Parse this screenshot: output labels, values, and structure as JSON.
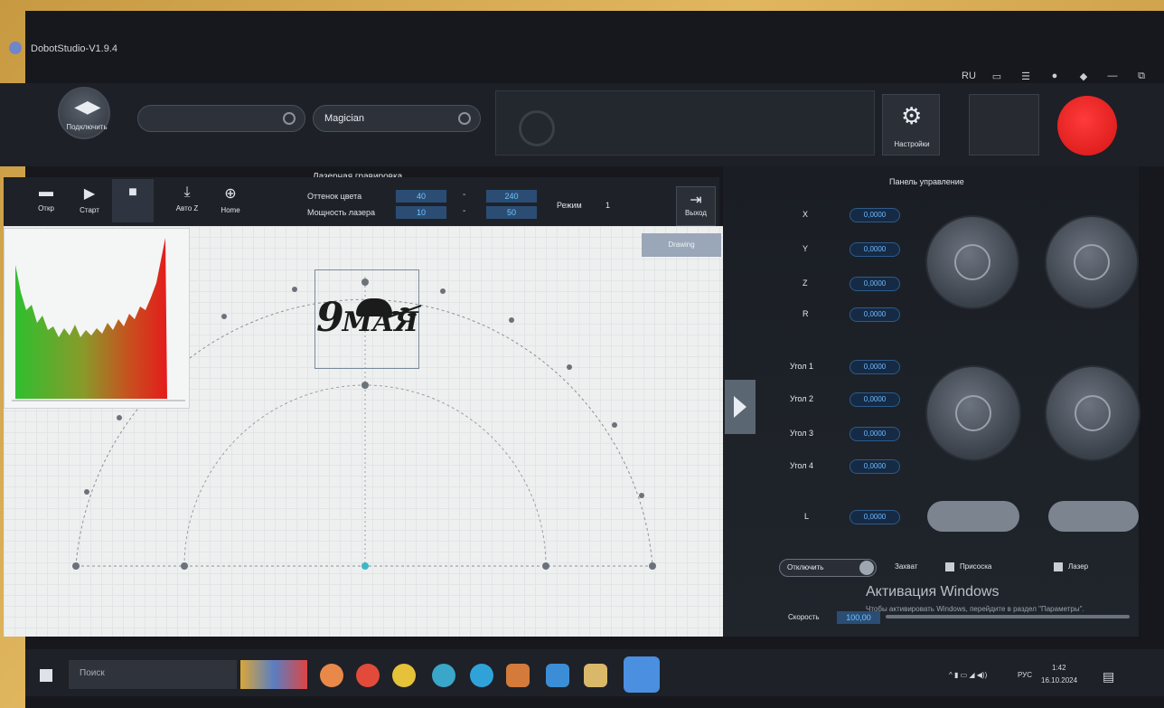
{
  "window": {
    "title": "DobotStudio-V1.9.4",
    "lang_button": "RU"
  },
  "topbar": {
    "connect_label": "Подключить",
    "port_value": "",
    "device_value": "Magician",
    "settings_label": "Настройки"
  },
  "laser": {
    "section_title": "Лазерная гравировка",
    "toolbar": {
      "open": "Откр",
      "start": "Старт",
      "auto": "Авто Z",
      "home": "Home"
    },
    "color_tone_label": "Оттенок цвета",
    "color_tone_min": "40",
    "color_tone_max": "240",
    "laser_power_label": "Мощность лазера",
    "laser_power_min": "10",
    "laser_power_max": "50",
    "mode_label": "Режим",
    "mode_value": "1",
    "exit_label": "Выход",
    "badge": "Drawing"
  },
  "workspace": {
    "logo_number": "9",
    "logo_text": "МАЯ"
  },
  "control_panel": {
    "title": "Панель управление",
    "axes": [
      {
        "label": "X",
        "value": "0,0000"
      },
      {
        "label": "Y",
        "value": "0,0000"
      },
      {
        "label": "Z",
        "value": "0,0000"
      },
      {
        "label": "R",
        "value": "0,0000"
      }
    ],
    "joints": [
      {
        "label": "Угол 1",
        "value": "0,0000"
      },
      {
        "label": "Угол 2",
        "value": "0,0000"
      },
      {
        "label": "Угол 3",
        "value": "0,0000"
      },
      {
        "label": "Угол 4",
        "value": "0,0000"
      }
    ],
    "l_label": "L",
    "l_value": "0,0000",
    "toggle_label": "Отключить",
    "grip_label": "Захват",
    "suction_label": "Присоска",
    "laser_label": "Лазер",
    "speed_label": "Скорость",
    "speed_value": "100,00"
  },
  "activation": {
    "title": "Активация Windows",
    "subtitle": "Чтобы активировать Windows, перейдите в раздел \"Параметры\"."
  },
  "taskbar": {
    "search_placeholder": "Поиск",
    "lang": "РУС",
    "time": "1:42",
    "date": "16.10.2024"
  }
}
